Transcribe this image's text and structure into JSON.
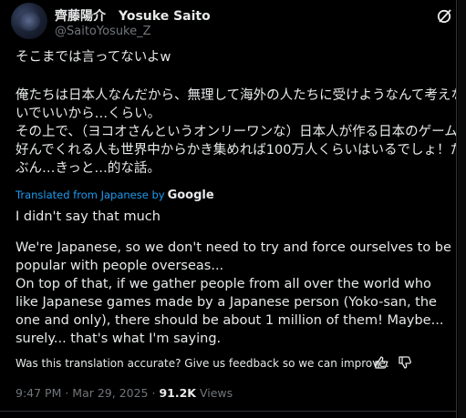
{
  "author": {
    "display_name_jp": "齊藤陽介",
    "display_name_en": "Yosuke Saito",
    "handle": "@SaitoYosuke_Z"
  },
  "post": {
    "original_line1": "そこまでは言ってないよw",
    "original_body": "俺たちは日本人なんだから、無理して海外の人たちに受けようなんて考えないでいいから…くらい。\nその上で、（ヨコオさんというオンリーワンな）日本人が作る日本のゲームを好んでくれる人も世界中からかき集めれば100万人くらいはいるでしょ！たぶん…きっと…的な話。",
    "translated_from": "Translated from Japanese by",
    "translator": "Google",
    "translation_line1": "I didn't say that much",
    "translation_body": "We're Japanese, so we don't need to try and force ourselves to be popular with people overseas...\nOn top of that, if we gather people from all over the world who like Japanese games made by a Japanese person (Yoko-san, the one and only), there should be about 1 million of them! Maybe... surely... that's what I'm saying.",
    "feedback_prompt": "Was this translation accurate? Give us feedback so we can improve:",
    "timestamp": "9:47 PM · Mar 29, 2025 ·",
    "views_count": "91.2K",
    "views_label": "Views"
  },
  "icons": {
    "grok": "grok-icon",
    "thumbs_up": "thumbs-up-icon",
    "thumbs_down": "thumbs-down-icon"
  },
  "colors": {
    "background": "#000000",
    "text": "#e7e9ea",
    "muted": "#71767b",
    "link": "#1d9bf0"
  }
}
